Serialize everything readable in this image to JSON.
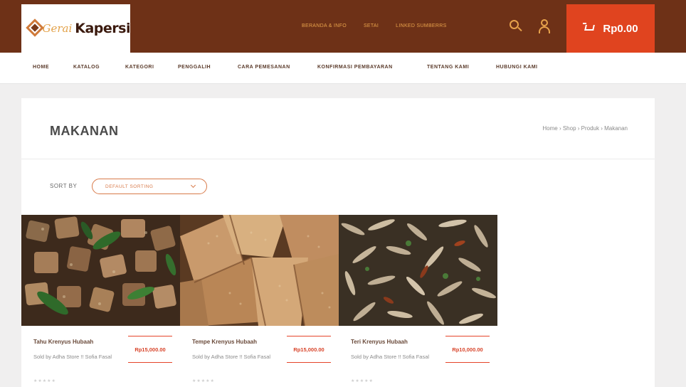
{
  "header": {
    "logo_script": "Gerai",
    "logo_text": "Kapersi",
    "top_links": [
      "BERANDA & INFO",
      "SETAI",
      "LINKED SUMBERRS"
    ],
    "cart_total": "Rp0.00"
  },
  "nav": {
    "items": [
      "HOME",
      "KATALOG",
      "KATEGORI",
      "PENGGALIH",
      "CARA PEMESANAN",
      "KONFIRMASI PEMBAYARAN",
      "TENTANG KAMI",
      "HUBUNGI KAMI"
    ]
  },
  "page": {
    "title": "MAKANAN",
    "breadcrumb": "Home › Shop › Produk › Makanan"
  },
  "sort": {
    "label": "SORT BY",
    "selected": "DEFAULT SORTING"
  },
  "products": [
    {
      "name": "Tahu Krenyus Hubaah",
      "seller": "Sold by Adha Store !! Sofia Fasal",
      "price": "Rp15,000.00",
      "rating": "★★★★★"
    },
    {
      "name": "Tempe Krenyus Hubaah",
      "seller": "Sold by Adha Store !! Sofia Fasal",
      "price": "Rp15,000.00",
      "rating": "★★★★★"
    },
    {
      "name": "Teri Krenyus Hubaah",
      "seller": "Sold by Adha Store !! Sofia Fasal",
      "price": "Rp10,000.00",
      "rating": "★★★★★"
    }
  ],
  "colors": {
    "header_bg": "#6e3117",
    "accent_orange": "#e0441f",
    "link_gold": "#e7a24b"
  }
}
